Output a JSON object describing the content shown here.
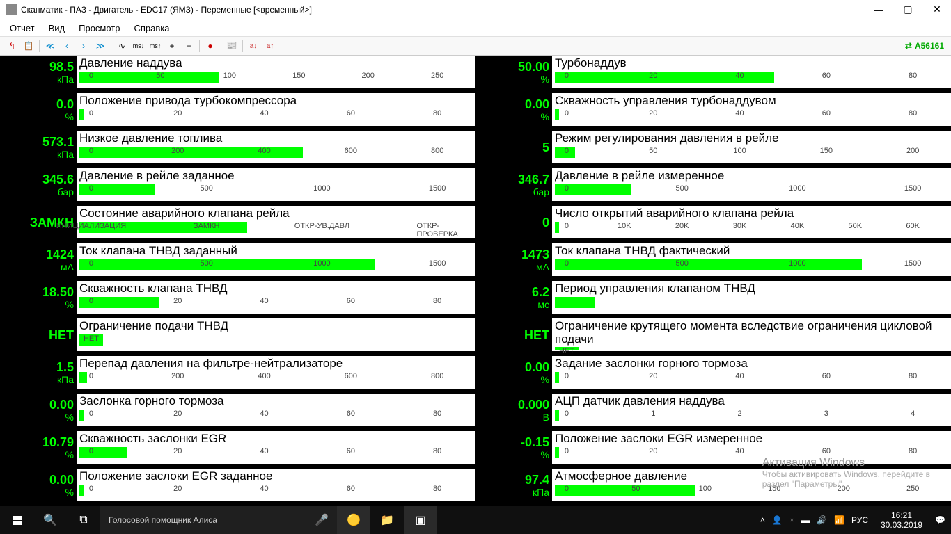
{
  "title": "Сканматик - ПАЗ - Двигатель - EDC17 (ЯМЗ) - Переменные [<временный>]",
  "menu": {
    "report": "Отчет",
    "view": "Вид",
    "preview": "Просмотр",
    "help": "Справка"
  },
  "toolbar_code": "A56161",
  "gauges_left": [
    {
      "val": "98.5",
      "unit": "кПа",
      "label": "Давление наддува",
      "fill": 35,
      "ticks": [
        "0",
        "50",
        "100",
        "150",
        "200",
        "250"
      ]
    },
    {
      "val": "0.0",
      "unit": "%",
      "label": "Положение привода турбокомпрессора",
      "fill": 1,
      "ticks": [
        "0",
        "20",
        "40",
        "60",
        "80"
      ]
    },
    {
      "val": "573.1",
      "unit": "кПа",
      "label": "Низкое давление топлива",
      "fill": 56,
      "ticks": [
        "0",
        "200",
        "400",
        "600",
        "800"
      ]
    },
    {
      "val": "345.6",
      "unit": "бар",
      "label": "Давление в рейле заданное",
      "fill": 19,
      "ticks": [
        "0",
        "500",
        "1000",
        "1500"
      ]
    },
    {
      "val": "ЗАМКН",
      "unit": "",
      "label": "Состояние аварийного клапана рейла",
      "fill": 42,
      "ticks": [
        "ИНИЦИАЛИЗАЦИЯ",
        "ЗАМКН",
        "ОТКР-УВ.ДАВЛ",
        "ОТКР-ПРОВЕРКА"
      ]
    },
    {
      "val": "1424",
      "unit": "мА",
      "label": "Ток клапана ТНВД заданный",
      "fill": 74,
      "ticks": [
        "0",
        "500",
        "1000",
        "1500"
      ]
    },
    {
      "val": "18.50",
      "unit": "%",
      "label": "Скважность клапана ТНВД",
      "fill": 20,
      "ticks": [
        "0",
        "20",
        "40",
        "60",
        "80"
      ]
    },
    {
      "val": "НЕТ",
      "unit": "",
      "label": "Ограничение подачи ТНВД",
      "fill": 6,
      "ticks": [
        "НЕТ"
      ]
    },
    {
      "val": "1.5",
      "unit": "кПа",
      "label": "Перепад давления на фильтре-нейтрализаторе",
      "fill": 2,
      "ticks": [
        "0",
        "200",
        "400",
        "600",
        "800"
      ]
    },
    {
      "val": "0.00",
      "unit": "%",
      "label": "Заслонка горного тормоза",
      "fill": 1,
      "ticks": [
        "0",
        "20",
        "40",
        "60",
        "80"
      ]
    },
    {
      "val": "10.79",
      "unit": "%",
      "label": "Скважность заслонки EGR",
      "fill": 12,
      "ticks": [
        "0",
        "20",
        "40",
        "60",
        "80"
      ]
    },
    {
      "val": "0.00",
      "unit": "%",
      "label": "Положение заслоки EGR заданное",
      "fill": 1,
      "ticks": [
        "0",
        "20",
        "40",
        "60",
        "80"
      ]
    }
  ],
  "gauges_right": [
    {
      "val": "50.00",
      "unit": "%",
      "label": "Турбонаддув",
      "fill": 55,
      "ticks": [
        "0",
        "20",
        "40",
        "60",
        "80"
      ]
    },
    {
      "val": "0.00",
      "unit": "%",
      "label": "Скважность управления турбонаддувом",
      "fill": 1,
      "ticks": [
        "0",
        "20",
        "40",
        "60",
        "80"
      ]
    },
    {
      "val": "5",
      "unit": "",
      "label": "Режим регулирования давления в рейле",
      "fill": 5,
      "ticks": [
        "0",
        "50",
        "100",
        "150",
        "200"
      ]
    },
    {
      "val": "346.7",
      "unit": "бар",
      "label": "Давление в рейле измеренное",
      "fill": 19,
      "ticks": [
        "0",
        "500",
        "1000",
        "1500"
      ]
    },
    {
      "val": "0",
      "unit": "",
      "label": "Число открытий аварийного клапана рейла",
      "fill": 1,
      "ticks": [
        "0",
        "10K",
        "20K",
        "30K",
        "40K",
        "50K",
        "60K"
      ]
    },
    {
      "val": "1473",
      "unit": "мА",
      "label": "Ток клапана ТНВД фактический",
      "fill": 77,
      "ticks": [
        "0",
        "500",
        "1000",
        "1500"
      ]
    },
    {
      "val": "6.2",
      "unit": "мс",
      "label": "Период управления клапаном ТНВД",
      "fill": 10,
      "ticks": [
        "",
        "",
        "",
        "",
        ""
      ]
    },
    {
      "val": "НЕТ",
      "unit": "",
      "label": "Ограничение крутящего момента вследствие ограничения цикловой подачи",
      "fill": 6,
      "ticks": [
        "НЕТ"
      ]
    },
    {
      "val": "0.00",
      "unit": "%",
      "label": "Задание заслонки горного тормоза",
      "fill": 1,
      "ticks": [
        "0",
        "20",
        "40",
        "60",
        "80"
      ]
    },
    {
      "val": "0.000",
      "unit": "В",
      "label": "АЦП датчик давления наддува",
      "fill": 1,
      "ticks": [
        "0",
        "1",
        "2",
        "3",
        "4"
      ]
    },
    {
      "val": "-0.15",
      "unit": "%",
      "label": "Положение заслоки EGR измеренное",
      "fill": 1,
      "ticks": [
        "0",
        "20",
        "40",
        "60",
        "80"
      ]
    },
    {
      "val": "97.4",
      "unit": "кПа",
      "label": "Атмосферное давление",
      "fill": 35,
      "ticks": [
        "0",
        "50",
        "100",
        "150",
        "200",
        "250"
      ]
    }
  ],
  "watermark": {
    "title": "Активация Windows",
    "sub1": "Чтобы активировать Windows, перейдите в",
    "sub2": "раздел \"Параметры\"."
  },
  "taskbar": {
    "search_placeholder": "Голосовой помощник Алиса",
    "lang": "РУС",
    "time": "16:21",
    "date": "30.03.2019"
  }
}
